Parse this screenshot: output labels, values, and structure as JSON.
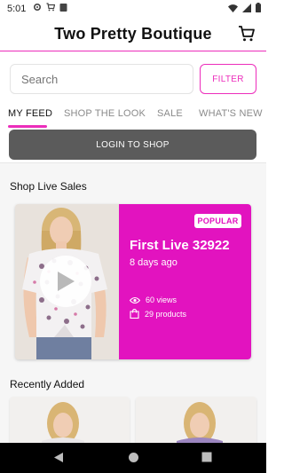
{
  "status_bar": {
    "time": "5:01",
    "left_icons": [
      "settings-icon",
      "cart-icon",
      "clipboard-icon"
    ],
    "right_icons": [
      "wifi-icon",
      "signal-icon",
      "battery-icon"
    ]
  },
  "app_bar": {
    "title": "Two Pretty Boutique",
    "cart_icon": "cart-icon"
  },
  "search": {
    "placeholder": "Search",
    "value": ""
  },
  "filter_label": "FILTER",
  "tabs": [
    {
      "label": "MY FEED",
      "active": true
    },
    {
      "label": "SHOP THE LOOK",
      "active": false
    },
    {
      "label": "SALE",
      "active": false
    },
    {
      "label": "WHAT'S NEW",
      "active": false
    }
  ],
  "login_label": "LOGIN TO SHOP",
  "live_sales": {
    "heading": "Shop Live Sales",
    "card": {
      "badge": "POPULAR",
      "title": "First Live 32922",
      "date": "8 days ago",
      "views": "60 views",
      "products": "29 products"
    }
  },
  "recently_added": {
    "heading": "Recently Added"
  },
  "colors": {
    "accent": "#ec2dbb",
    "live_panel": "#e213bf",
    "login_button": "#5b5b5b"
  },
  "nav_bar": [
    "back-icon",
    "home-icon",
    "recents-icon"
  ]
}
